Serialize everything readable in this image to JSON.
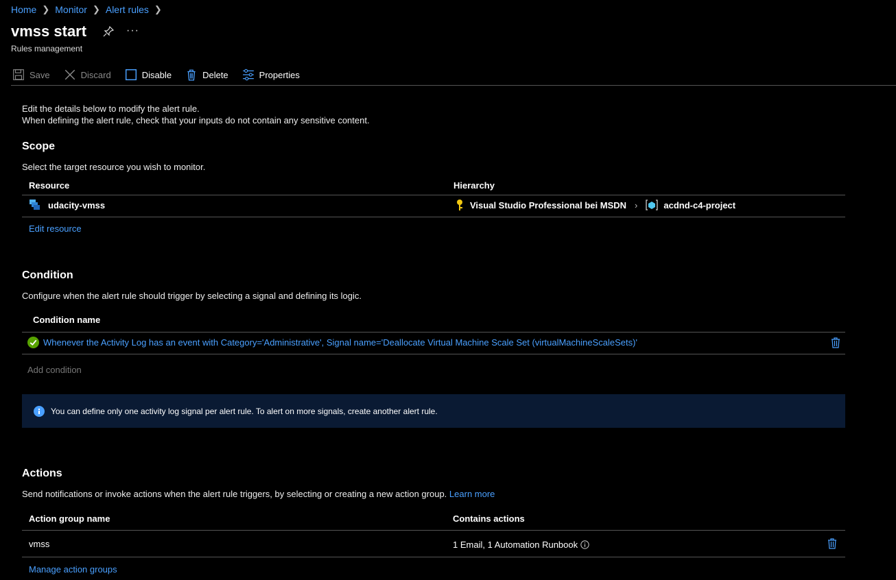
{
  "breadcrumb": [
    "Home",
    "Monitor",
    "Alert rules"
  ],
  "page": {
    "title": "vmss start",
    "subtitle": "Rules management"
  },
  "toolbar": {
    "save": "Save",
    "discard": "Discard",
    "disable": "Disable",
    "delete": "Delete",
    "properties": "Properties"
  },
  "intro": {
    "line1": "Edit the details below to modify the alert rule.",
    "line2": "When defining the alert rule, check that your inputs do not contain any sensitive content."
  },
  "scope": {
    "heading": "Scope",
    "description": "Select the target resource you wish to monitor.",
    "col_resource": "Resource",
    "col_hierarchy": "Hierarchy",
    "resource": "udacity-vmss",
    "hierarchy_subscription": "Visual Studio Professional bei MSDN",
    "hierarchy_group": "acdnd-c4-project",
    "edit_link": "Edit resource"
  },
  "condition": {
    "heading": "Condition",
    "description": "Configure when the alert rule should trigger by selecting a signal and defining its logic.",
    "col_name": "Condition name",
    "row": "Whenever the Activity Log has an event with Category='Administrative', Signal name='Deallocate Virtual Machine Scale Set (virtualMachineScaleSets)'",
    "add": "Add condition",
    "info": "You can define only one activity log signal per alert rule. To alert on more signals, create another alert rule."
  },
  "actions": {
    "heading": "Actions",
    "description": "Send notifications or invoke actions when the alert rule triggers, by selecting or creating a new action group.",
    "learn_more": "Learn more",
    "col_name": "Action group name",
    "col_contains": "Contains actions",
    "row_name": "vmss",
    "row_contains": "1 Email, 1 Automation Runbook",
    "manage_link": "Manage action groups"
  },
  "colors": {
    "link": "#4aa0ff",
    "info_bg": "#0a1a33",
    "success": "#57a300"
  }
}
